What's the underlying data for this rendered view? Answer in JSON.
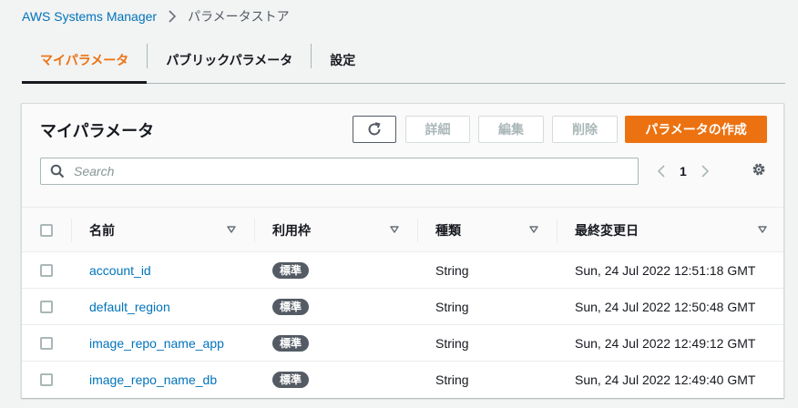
{
  "breadcrumb": {
    "root": "AWS Systems Manager",
    "current": "パラメータストア"
  },
  "tabs": [
    {
      "label": "マイパラメータ",
      "active": true
    },
    {
      "label": "パブリックパラメータ",
      "active": false
    },
    {
      "label": "設定",
      "active": false
    }
  ],
  "panel": {
    "title": "マイパラメータ",
    "buttons": {
      "detail": "詳細",
      "edit": "編集",
      "delete": "削除",
      "create": "パラメータの作成"
    },
    "search": {
      "placeholder": "Search",
      "value": ""
    },
    "pager": {
      "page": "1"
    }
  },
  "table": {
    "columns": [
      "名前",
      "利用枠",
      "種類",
      "最終変更日"
    ],
    "rows": [
      {
        "name": "account_id",
        "tier": "標準",
        "type": "String",
        "modified": "Sun, 24 Jul 2022 12:51:18 GMT"
      },
      {
        "name": "default_region",
        "tier": "標準",
        "type": "String",
        "modified": "Sun, 24 Jul 2022 12:50:48 GMT"
      },
      {
        "name": "image_repo_name_app",
        "tier": "標準",
        "type": "String",
        "modified": "Sun, 24 Jul 2022 12:49:12 GMT"
      },
      {
        "name": "image_repo_name_db",
        "tier": "標準",
        "type": "String",
        "modified": "Sun, 24 Jul 2022 12:49:40 GMT"
      }
    ]
  },
  "colors": {
    "accent": "#ec7211",
    "link": "#0073bb",
    "badge": "#545b64"
  },
  "icons": [
    "chevron-right-icon",
    "refresh-icon",
    "search-icon",
    "chevron-left-icon",
    "gear-icon",
    "sort-icon"
  ]
}
